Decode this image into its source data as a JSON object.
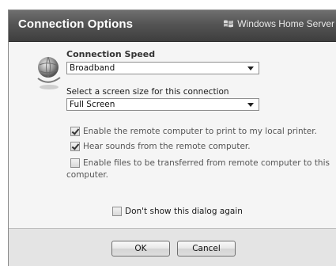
{
  "window": {
    "title": "Connection Options",
    "brand": "Windows Home Server"
  },
  "connection_speed": {
    "label": "Connection Speed",
    "selected": "Broadband"
  },
  "screen_size": {
    "label": "Select a screen size for this connection",
    "selected": "Full Screen"
  },
  "options": [
    {
      "label": "Enable the remote computer to print to my local printer.",
      "checked": true
    },
    {
      "label": "Hear sounds from the remote computer.",
      "checked": true
    },
    {
      "label": "Enable files to be transferred from remote computer to this",
      "label_cont": "computer.",
      "checked": false
    }
  ],
  "dont_show": {
    "label": "Don't show this dialog again",
    "checked": false
  },
  "buttons": {
    "ok": "OK",
    "cancel": "Cancel"
  }
}
